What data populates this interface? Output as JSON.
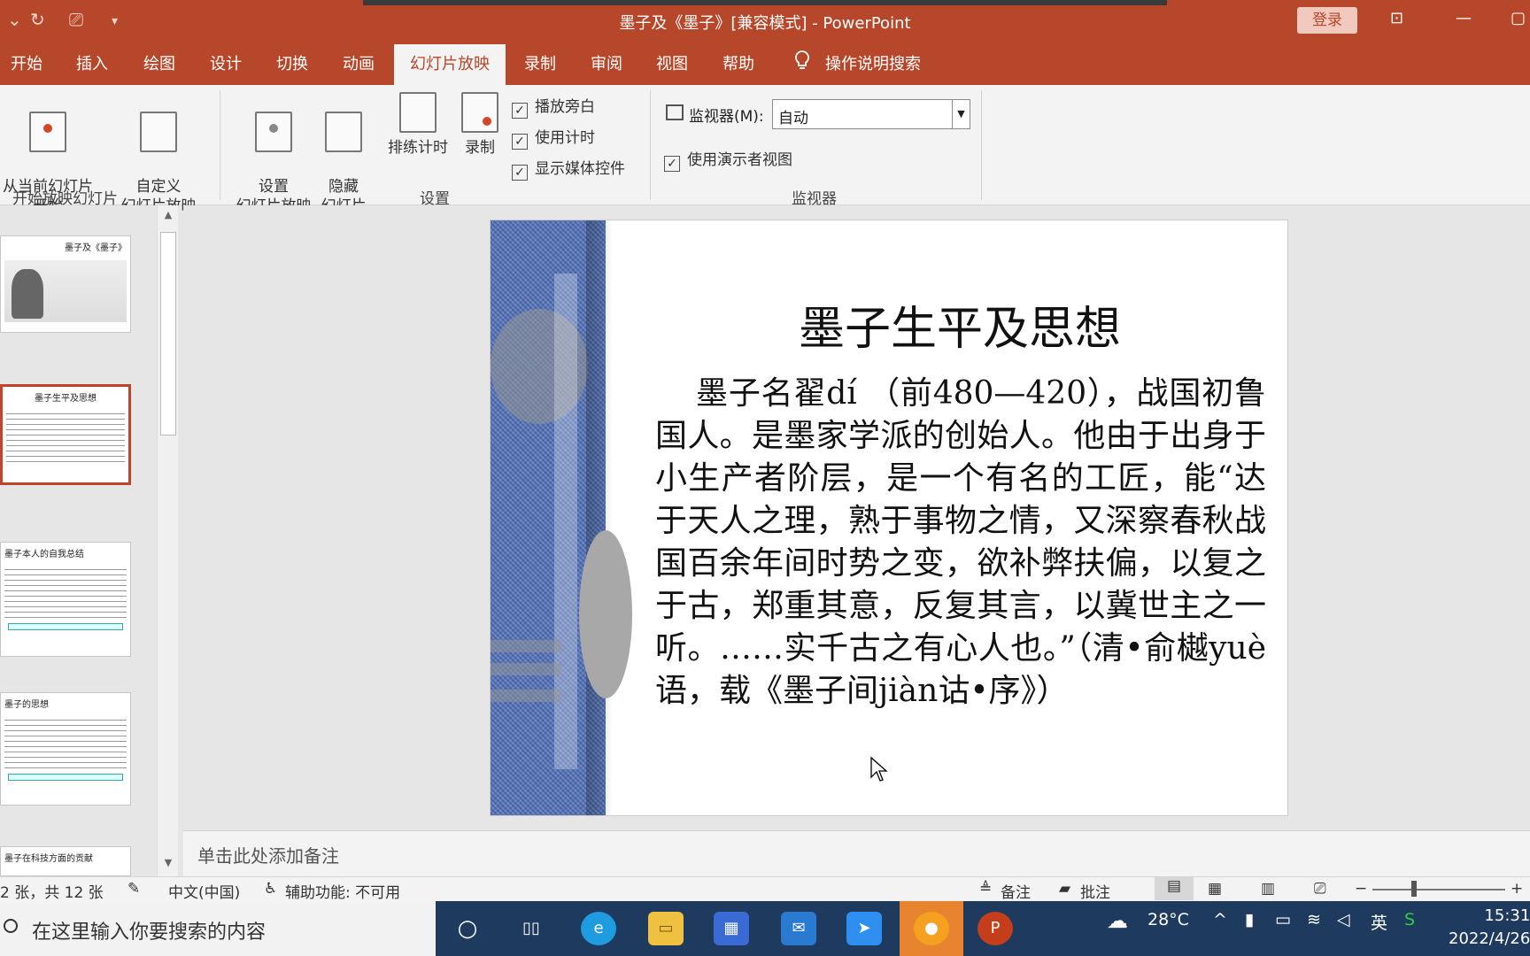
{
  "window": {
    "title": "墨子及《墨子》[兼容模式]  -  PowerPoint",
    "login_label": "登录"
  },
  "tabs": [
    {
      "label": "开始"
    },
    {
      "label": "插入"
    },
    {
      "label": "绘图"
    },
    {
      "label": "设计"
    },
    {
      "label": "切换"
    },
    {
      "label": "动画"
    },
    {
      "label": "幻灯片放映",
      "active": true
    },
    {
      "label": "录制"
    },
    {
      "label": "审阅"
    },
    {
      "label": "视图"
    },
    {
      "label": "帮助"
    }
  ],
  "tell_me": "操作说明搜索",
  "ribbon": {
    "from_current": "从当前幻灯片\n开始",
    "custom_show": "自定义\n幻灯片放映",
    "group_start": "开始放映幻灯片",
    "setup_show": "设置\n幻灯片放映",
    "hide_slide": "隐藏\n幻灯片",
    "rehearse": "排练计时",
    "record": "录制",
    "chk_narration": "播放旁白",
    "chk_timing": "使用计时",
    "chk_media": "显示媒体控件",
    "group_setup": "设置",
    "monitor_label": "监视器(M):",
    "monitor_value": "自动",
    "chk_presenter": "使用演示者视图",
    "group_monitor": "监视器"
  },
  "thumbs": {
    "t1_title": "墨子及《墨子》",
    "t2_title": "墨子生平及思想",
    "t3_title": "墨子本人的自我总结",
    "t4_title": "墨子的思想",
    "t5_title": "墨子在科技方面的贡献"
  },
  "slide": {
    "title": "墨子生平及思想",
    "body": "墨子名翟dí （前480—420），战国初鲁国人。是墨家学派的创始人。他由于出身于小生产者阶层，是一个有名的工匠，能“达于天人之理，熟于事物之情，又深察春秋战国百余年间时势之变，欲补弊扶偏，以复之于古，郑重其意，反复其言，以冀世主之一听。……实千古之有心人也。”（清•俞樾yuè语，载《墨子间jiàn诂•序》）"
  },
  "notes_placeholder": "单击此处添加备注",
  "status": {
    "slide_count": "2 张，共 12 张",
    "language": "中文(中国)",
    "accessibility": "辅助功能: 不可用",
    "notes_btn": "备注",
    "comments_btn": "批注"
  },
  "taskbar": {
    "search_placeholder": "在这里输入你要搜索的内容",
    "temperature": "28°C",
    "ime": "英",
    "time": "15:31",
    "date": "2022/4/26"
  }
}
